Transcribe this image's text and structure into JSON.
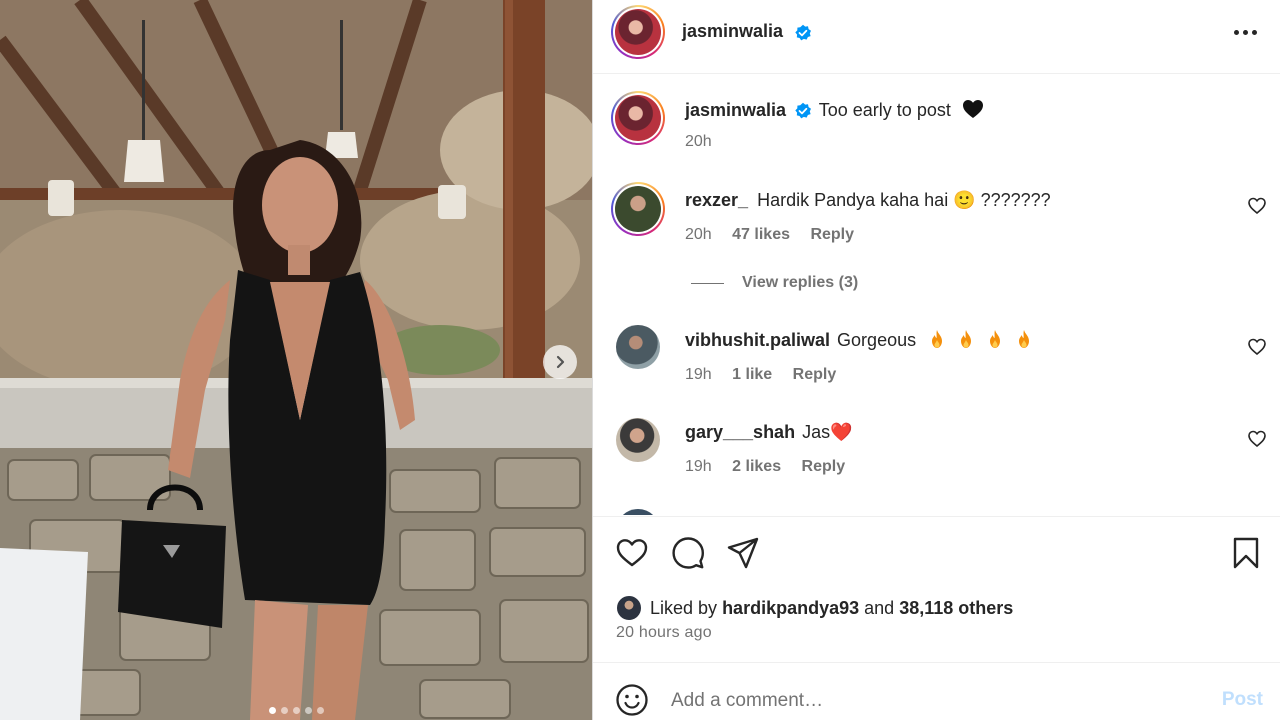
{
  "post": {
    "author": "jasminwalia",
    "verified": true,
    "image_count": 5,
    "active_image_index": 0
  },
  "caption": {
    "username": "jasminwalia",
    "text": "Too early to post",
    "emoji": "black-heart",
    "time": "20h"
  },
  "comments": [
    {
      "username": "rexzer_",
      "text": "Hardik Pandya kaha hai 🙂 ???????",
      "time": "20h",
      "likes": "47 likes",
      "reply_label": "Reply",
      "view_replies": "View replies (3)"
    },
    {
      "username": "vibhushit.paliwal",
      "text": "Gorgeous",
      "trailing_emoji": [
        "fire",
        "fire",
        "fire",
        "fire"
      ],
      "time": "19h",
      "likes": "1 like",
      "reply_label": "Reply"
    },
    {
      "username": "gary___shah",
      "text": "Jas❤️",
      "time": "19h",
      "likes": "2 likes",
      "reply_label": "Reply"
    }
  ],
  "likes": {
    "prefix": "Liked by",
    "user": "hardikpandya93",
    "conjunction": "and",
    "others": "38,118 others"
  },
  "timestamp": "20 hours ago",
  "add_comment": {
    "placeholder": "Add a comment…",
    "post_label": "Post"
  },
  "icons": {
    "header_more": "more-horizontal-icon",
    "like": "heart-icon",
    "comment": "comment-icon",
    "share": "send-icon",
    "save": "bookmark-icon",
    "emoji": "smile-icon",
    "carousel_next": "chevron-right-icon"
  },
  "colors": {
    "verified": "#0095f6",
    "text_primary": "#262626",
    "text_secondary": "#737373",
    "post_disabled": "#c0dffd"
  }
}
